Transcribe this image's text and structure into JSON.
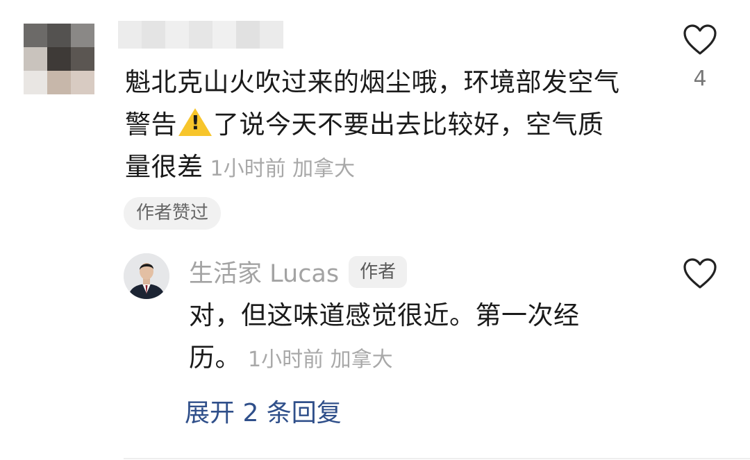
{
  "comment": {
    "text_line1": "魁北克山火吹过来的烟尘哦，环境部发空气",
    "text_line2a": "警告",
    "text_line2b": "了说今天不要出去比较好，空气质",
    "text_line3": "量很差",
    "time": "1小时前",
    "location": "加拿大",
    "like_count": "4",
    "author_liked": "作者赞过",
    "warning_icon": "warning-sign-emoji"
  },
  "reply": {
    "username": "生活家 Lucas",
    "author_tag": "作者",
    "text_line1": "对，但这味道感觉很近。第一次经",
    "text_line2": "历。",
    "time": "1小时前",
    "location": "加拿大"
  },
  "expand_replies": "展开 2 条回复",
  "colors": {
    "text": "#1a1a1a",
    "meta": "#a8a8a8",
    "link": "#2f4f8a",
    "warning": "#f7c52b"
  }
}
